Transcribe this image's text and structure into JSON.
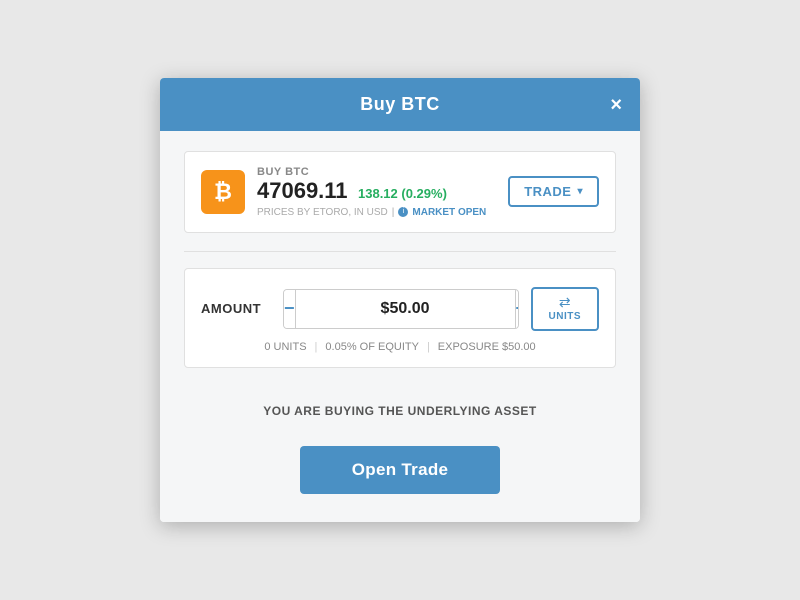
{
  "modal": {
    "title": "Buy BTC",
    "close_label": "×"
  },
  "asset": {
    "label": "BUY BTC",
    "icon_symbol": "₿",
    "price": "47069.11",
    "change": "138.12 (0.29%)",
    "meta": "PRICES BY ETORO, IN USD",
    "market_status": "MARKET OPEN",
    "trade_button": "TRADE"
  },
  "order": {
    "amount_label": "AMOUNT",
    "amount_value": "$50.00",
    "units_label": "UNITS",
    "units_icon": "⇄",
    "minus_label": "−",
    "plus_label": "+",
    "units_count": "0 UNITS",
    "equity_pct": "0.05% OF EQUITY",
    "exposure": "EXPOSURE $50.00",
    "underlying_msg": "YOU ARE BUYING THE UNDERLYING ASSET"
  },
  "footer": {
    "open_trade_label": "Open Trade"
  }
}
